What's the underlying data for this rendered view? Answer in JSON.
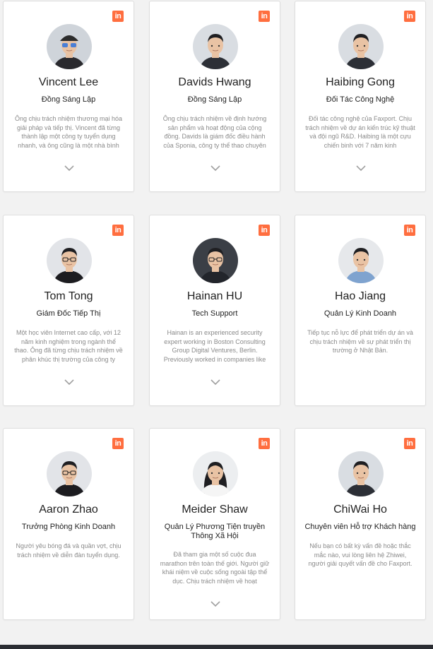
{
  "linkedin_label": "in",
  "team": [
    {
      "name": "Vincent Lee",
      "role": "Đồng Sáng Lập",
      "description": "Ông chịu trách nhiệm thương mại hóa giải pháp và tiếp thị. Vincent đã từng thành lập một công ty tuyển dụng nhanh, và ông cũng là một nhà bình",
      "photo": "avatar-glasses-cap"
    },
    {
      "name": "Davids Hwang",
      "role": "Đồng Sáng Lập",
      "description": "Ông chịu trách nhiệm về định hướng sản phẩm và hoạt động của cộng đồng. Davids là giám đốc điều hành của Sponia, công ty thể thao chuyên",
      "photo": "avatar-short-hair"
    },
    {
      "name": "Haibing Gong",
      "role": "Đối Tác Công Nghệ",
      "description": "Đối tác công nghệ của Faxport. Chịu trách nhiệm về dự án kiến trúc kỹ thuật và đội ngũ R&D. Haibing là một cựu chiến binh với 7 năm kinh",
      "photo": "avatar-short-hair"
    },
    {
      "name": "Tom Tong",
      "role": "Giám Đốc Tiếp Thị",
      "description": "Một học viên Internet cao cấp, với 12 năm kinh nghiệm trong ngành thể thao. Ông đã từng chịu trách nhiệm về phân khúc thị trường của công ty",
      "photo": "avatar-glasses"
    },
    {
      "name": "Hainan HU",
      "role": "Tech Support",
      "description": "Hainan is an experienced security expert working in Boston Consulting Group Digital Ventures, Berlin. Previously worked in companies like",
      "photo": "avatar-glasses-dark"
    },
    {
      "name": "Hao Jiang",
      "role": "Quản Lý Kinh Doanh",
      "description": "Tiếp tục nỗ lực để phát triển dự án và chịu trách nhiệm về sự phát triển thị trường ở Nhật Bản.",
      "photo": "avatar-shirt-blue"
    },
    {
      "name": "Aaron Zhao",
      "role": "Trưởng Phòng Kinh Doanh",
      "description": "Người yêu bóng đá và quần vợt, chịu trách nhiệm về diễn đàn tuyển dụng.",
      "photo": "avatar-glasses"
    },
    {
      "name": "Meider Shaw",
      "role": "Quản Lý Phương Tiện truyền Thông Xã Hội",
      "description": "Đã tham gia một số cuộc đua marathon trên toàn thế giới. Người giữ khái niệm về cuộc sống ngoài tập thể dục. Chịu trách nhiệm về hoạt",
      "photo": "avatar-long-hair"
    },
    {
      "name": "ChiWai Ho",
      "role": "Chuyên viên Hỗ trợ Khách hàng",
      "description": "Nếu bạn có bất kỳ vấn đề hoặc thắc mắc nào, vui lòng liên hệ Zhiwei, người giải quyết vấn đề cho Faxport.",
      "photo": "avatar-short-hair"
    }
  ]
}
